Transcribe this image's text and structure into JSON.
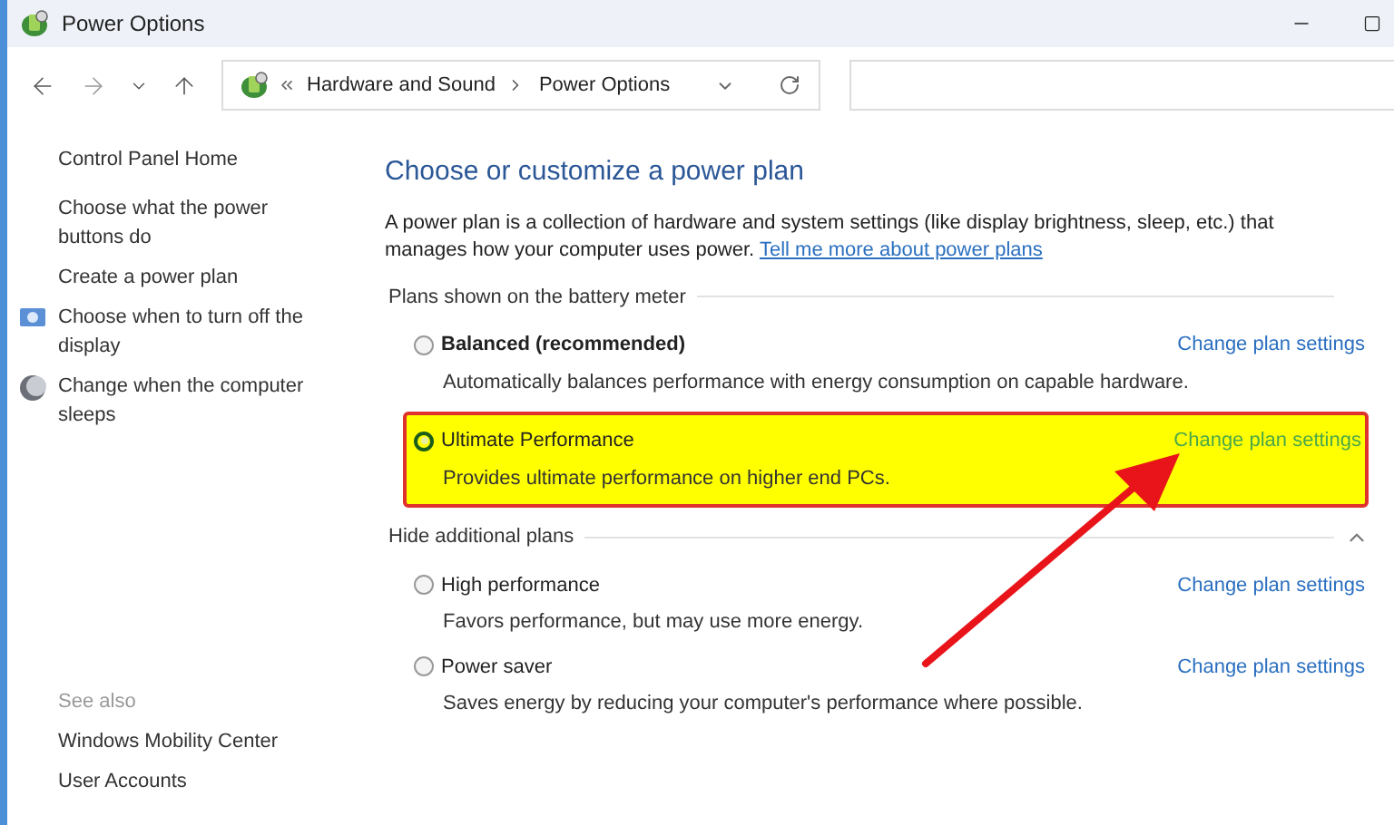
{
  "window": {
    "title": "Power Options"
  },
  "address_bar": {
    "breadcrumbs": [
      "Hardware and Sound",
      "Power Options"
    ]
  },
  "sidebar": {
    "items": [
      {
        "label": "Control Panel Home",
        "kind": "plain"
      },
      {
        "label": "Choose what the power buttons do",
        "kind": "plain"
      },
      {
        "label": "Create a power plan",
        "kind": "plain"
      },
      {
        "label": "Choose when to turn off the display",
        "kind": "display"
      },
      {
        "label": "Change when the computer sleeps",
        "kind": "sleep"
      }
    ],
    "see_also": {
      "title": "See also",
      "items": [
        "Windows Mobility Center",
        "User Accounts"
      ]
    }
  },
  "main": {
    "heading": "Choose or customize a power plan",
    "description": "A power plan is a collection of hardware and system settings (like display brightness, sleep, etc.) that manages how your computer uses power.",
    "link": "Tell me more about power plans"
  },
  "groups": [
    {
      "title": "Plans shown on the battery meter",
      "collapsible": false,
      "plans": [
        {
          "name": "Balanced (recommended)",
          "bold": true,
          "selected": false,
          "highlighted": false,
          "description": "Automatically balances performance with energy consumption on capable hardware.",
          "link": "Change plan settings"
        },
        {
          "name": "Ultimate Performance",
          "bold": false,
          "selected": true,
          "highlighted": true,
          "description": "Provides ultimate performance on higher end PCs.",
          "link": "Change plan settings"
        }
      ]
    },
    {
      "title": "Hide additional plans",
      "collapsible": true,
      "plans": [
        {
          "name": "High performance",
          "bold": false,
          "selected": false,
          "highlighted": false,
          "description": "Favors performance, but may use more energy.",
          "link": "Change plan settings"
        },
        {
          "name": "Power saver",
          "bold": false,
          "selected": false,
          "highlighted": false,
          "description": "Saves energy by reducing your computer's performance where possible.",
          "link": "Change plan settings"
        }
      ]
    }
  ]
}
